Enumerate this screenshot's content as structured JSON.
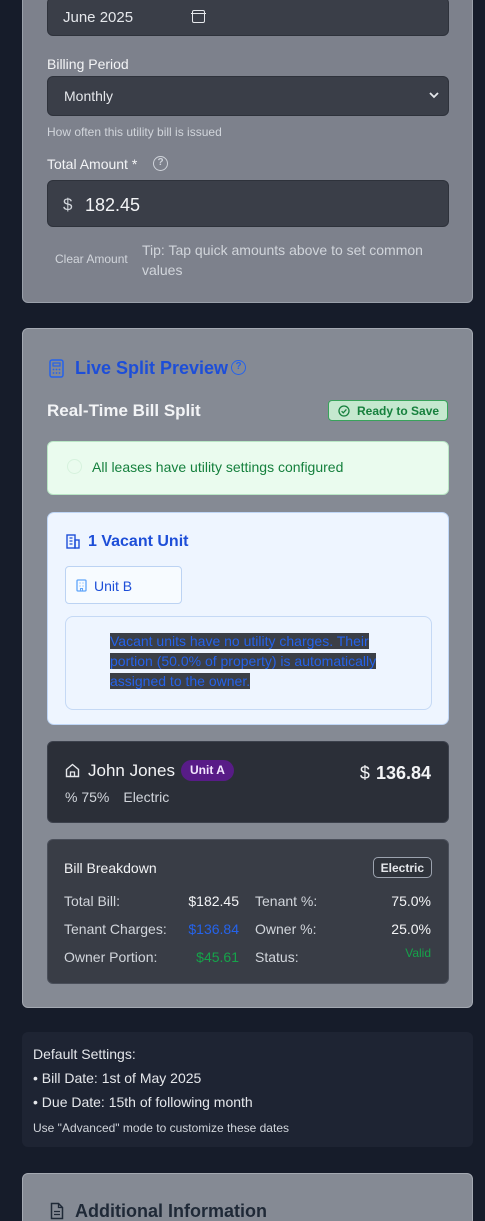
{
  "form": {
    "month_value": "June  2025",
    "billing_period_label": "Billing Period",
    "billing_period_value": "Monthly",
    "billing_period_hint": "How often this utility bill is issued",
    "total_amount_label": "Total Amount *",
    "help_glyph": "?",
    "currency_symbol": "$",
    "total_amount_value": "182.45",
    "clear_amount_label": "Clear Amount",
    "tip": "Tip: Tap quick amounts above to set common values"
  },
  "preview": {
    "title": "Live Split Preview",
    "subtitle": "Real-Time Bill Split",
    "status_badge": "Ready to Save",
    "lease_message": "All leases have utility settings configured",
    "vacant": {
      "title": "1 Vacant Unit",
      "unit": "Unit B",
      "note": "Vacant units have no utility charges. Their portion (50.0% of property) is automatically assigned to the owner."
    },
    "tenant": {
      "name": "John Jones",
      "unit": "Unit A",
      "percent": "% 75%",
      "utility": "Electric",
      "currency": "$",
      "amount": "136.84"
    },
    "breakdown": {
      "title": "Bill Breakdown",
      "badge": "Electric",
      "total_bill_label": "Total Bill:",
      "total_bill_value": "$182.45",
      "tenant_pct_label": "Tenant %:",
      "tenant_pct_value": "75.0%",
      "tenant_charges_label": "Tenant Charges:",
      "tenant_charges_value": "$136.84",
      "owner_pct_label": "Owner %:",
      "owner_pct_value": "25.0%",
      "owner_portion_label": "Owner Portion:",
      "owner_portion_value": "$45.61",
      "status_label": "Status:",
      "status_value": "Valid"
    }
  },
  "defaults": {
    "heading": "Default Settings:",
    "bill_date": "• Bill Date: 1st of May 2025",
    "due_date": "• Due Date: 15th of following month",
    "advanced_note": "Use \"Advanced\" mode to customize these dates"
  },
  "additional": {
    "title": "Additional Information"
  },
  "colors": {
    "accent_blue": "#1d4ed8",
    "success_green": "#16a34a",
    "unit_badge_purple": "#581c87"
  }
}
